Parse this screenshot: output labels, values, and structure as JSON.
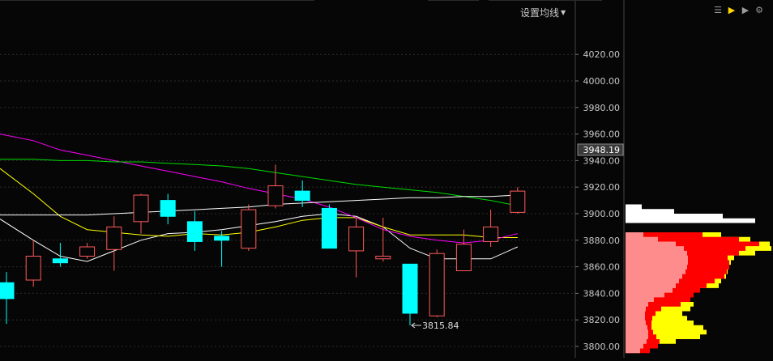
{
  "toolbar": {
    "ma_setting_label": "设置均线",
    "icons": [
      "list-icon",
      "volume-profile-icon",
      "play-icon",
      "settings-gear-icon"
    ]
  },
  "colors": {
    "background": "#060606",
    "up_candle": "#ff5a5a",
    "down_candle": "#00ffff",
    "axis_text": "#c8c8c8",
    "grid": "#2c2c2c",
    "ma5": "#ffffff",
    "ma10": "#ffff00",
    "ma20": "#ff00ff",
    "ma60": "#00dd00",
    "ma_long": "#ffffff",
    "profile_light": "#ff8c8c",
    "profile_red": "#ff0000",
    "profile_yellow": "#ffff00",
    "profile_white": "#ffffff"
  },
  "chart_data": {
    "type": "candlestick",
    "y_axis": {
      "ticks": [
        "4020.00",
        "4000.00",
        "3980.00",
        "3960.00",
        "3940.00",
        "3920.00",
        "3900.00",
        "3880.00",
        "3860.00",
        "3840.00",
        "3820.00",
        "3800.00"
      ],
      "range": [
        3790,
        4060
      ],
      "current_price": "3948.19"
    },
    "candles": [
      {
        "open": 3848,
        "high": 3856,
        "low": 3817,
        "close": 3836
      },
      {
        "open": 3850,
        "high": 3880,
        "low": 3845,
        "close": 3868
      },
      {
        "open": 3866,
        "high": 3878,
        "low": 3860,
        "close": 3863
      },
      {
        "open": 3868,
        "high": 3878,
        "low": 3866,
        "close": 3875
      },
      {
        "open": 3873,
        "high": 3898,
        "low": 3857,
        "close": 3890
      },
      {
        "open": 3894,
        "high": 3915,
        "low": 3885,
        "close": 3914
      },
      {
        "open": 3910,
        "high": 3915,
        "low": 3892,
        "close": 3898
      },
      {
        "open": 3894,
        "high": 3902,
        "low": 3872,
        "close": 3879
      },
      {
        "open": 3883,
        "high": 3887,
        "low": 3860,
        "close": 3880
      },
      {
        "open": 3874,
        "high": 3907,
        "low": 3872,
        "close": 3903
      },
      {
        "open": 3906,
        "high": 3937,
        "low": 3904,
        "close": 3921
      },
      {
        "open": 3917,
        "high": 3925,
        "low": 3905,
        "close": 3910
      },
      {
        "open": 3904,
        "high": 3907,
        "low": 3876,
        "close": 3874
      },
      {
        "open": 3872,
        "high": 3897,
        "low": 3852,
        "close": 3890
      },
      {
        "open": 3866,
        "high": 3897,
        "low": 3864,
        "close": 3868
      },
      {
        "open": 3862,
        "high": 3862,
        "low": 3815.84,
        "close": 3825
      },
      {
        "open": 3823,
        "high": 3873,
        "low": 3822,
        "close": 3870
      },
      {
        "open": 3857,
        "high": 3888,
        "low": 3857,
        "close": 3877
      },
      {
        "open": 3879,
        "high": 3903,
        "low": 3875,
        "close": 3890
      },
      {
        "open": 3901,
        "high": 3920,
        "low": 3900,
        "close": 3917
      }
    ],
    "moving_averages": [
      {
        "color": "#ffffff",
        "values": [
          3896,
          3880,
          3868,
          3864,
          3872,
          3880,
          3885,
          3886,
          3888,
          3891,
          3894,
          3898,
          3900,
          3898,
          3890,
          3874,
          3866,
          3866,
          3866,
          3875
        ]
      },
      {
        "color": "#ffff00",
        "values": [
          3934,
          3915,
          3898,
          3888,
          3886,
          3884,
          3883,
          3885,
          3884,
          3886,
          3890,
          3895,
          3897,
          3897,
          3890,
          3884,
          3884,
          3884,
          3882,
          3882
        ]
      },
      {
        "color": "#ff00ff",
        "values": [
          3960,
          3955,
          3948,
          3944,
          3940,
          3936,
          3932,
          3928,
          3924,
          3919,
          3915,
          3911,
          3905,
          3897,
          3888,
          3883,
          3880,
          3878,
          3880,
          3885
        ]
      },
      {
        "color": "#00dd00",
        "values": [
          3941,
          3941,
          3940,
          3940,
          3939,
          3939,
          3938,
          3937,
          3936,
          3934,
          3931,
          3928,
          3925,
          3922,
          3920,
          3918,
          3916,
          3913,
          3910,
          3906
        ]
      },
      {
        "color": "#ffffff",
        "values": [
          3899,
          3899,
          3899,
          3899,
          3900,
          3901,
          3902,
          3903,
          3904,
          3905,
          3907,
          3908,
          3909,
          3910,
          3911,
          3912,
          3912,
          3913,
          3913,
          3914
        ]
      }
    ],
    "low_label": "3815.84",
    "volume_profile": {
      "price_start": 3795,
      "price_step": 3.5,
      "light": [
        18,
        22,
        26,
        28,
        28,
        27,
        25,
        24,
        24,
        25,
        28,
        35,
        48,
        58,
        62,
        66,
        70,
        74,
        76,
        77,
        77,
        76,
        72,
        62,
        40,
        22
      ],
      "red": [
        30,
        40,
        42,
        38,
        34,
        32,
        32,
        33,
        37,
        44,
        68,
        80,
        84,
        92,
        100,
        110,
        122,
        125,
        128,
        128,
        126,
        140,
        148,
        165,
        140,
        95
      ],
      "yellow": [
        0,
        0,
        62,
        92,
        100,
        96,
        84,
        76,
        70,
        80,
        84,
        76,
        0,
        0,
        115,
        118,
        124,
        126,
        128,
        130,
        134,
        160,
        180,
        178,
        154,
        118
      ],
      "white": [
        0,
        0,
        0,
        0,
        0,
        0,
        0,
        0,
        0,
        0,
        0,
        0,
        0,
        0,
        0,
        0,
        0,
        0,
        0,
        0,
        0,
        0,
        0,
        0,
        0,
        0,
        0,
        0,
        160,
        120,
        60,
        20
      ]
    }
  }
}
